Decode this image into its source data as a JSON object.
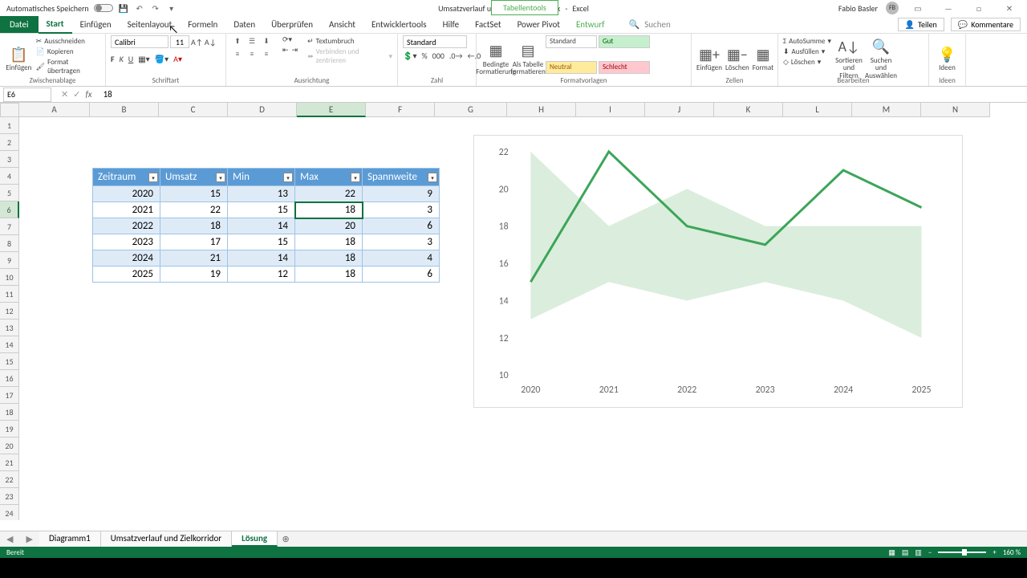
{
  "titlebar": {
    "autosave": "Automatisches Speichern",
    "doc_title": "Umsatzverlauf und Zielkorridor Grafik",
    "app_name": "Excel",
    "context_tool": "Tabellentools",
    "user": "Fabio Basler"
  },
  "tabs": {
    "file": "Datei",
    "list": [
      "Start",
      "Einfügen",
      "Seitenlayout",
      "Formeln",
      "Daten",
      "Überprüfen",
      "Ansicht",
      "Entwicklertools",
      "Hilfe",
      "FactSet",
      "Power Pivot"
    ],
    "context": "Entwurf",
    "search": "Suchen",
    "share": "Teilen",
    "comments": "Kommentare"
  },
  "ribbon": {
    "paste": "Einfügen",
    "cut": "Ausschneiden",
    "copy": "Kopieren",
    "formatpainter": "Format übertragen",
    "clipboard": "Zwischenablage",
    "font_name": "Calibri",
    "font_size": "11",
    "font_group": "Schriftart",
    "wrap": "Textumbruch",
    "merge": "Verbinden und zentrieren",
    "align_group": "Ausrichtung",
    "num_format": "Standard",
    "num_group": "Zahl",
    "cond": "Bedingte Formatierung",
    "astable": "Als Tabelle formatieren",
    "style_std": "Standard",
    "style_gut": "Gut",
    "style_neutral": "Neutral",
    "style_bad": "Schlecht",
    "styles_group": "Formatvorlagen",
    "insert": "Einfügen",
    "delete": "Löschen",
    "format": "Format",
    "cells_group": "Zellen",
    "autosum": "AutoSumme",
    "fill": "Ausfüllen",
    "clear": "Löschen",
    "sort": "Sortieren und Filtern",
    "find": "Suchen und Auswählen",
    "edit_group": "Bearbeiten",
    "ideas": "Ideen",
    "ideas_group": "Ideen"
  },
  "namebox": "E6",
  "formula": "18",
  "columns": [
    "A",
    "B",
    "C",
    "D",
    "E",
    "F",
    "G",
    "H",
    "I",
    "J",
    "K",
    "L",
    "M",
    "N"
  ],
  "rows": [
    "1",
    "2",
    "3",
    "4",
    "5",
    "6",
    "7",
    "8",
    "9",
    "10",
    "11",
    "12",
    "13",
    "14",
    "15",
    "16",
    "17",
    "18",
    "19",
    "20",
    "21",
    "22",
    "23",
    "24"
  ],
  "selected_col": "E",
  "selected_row": "6",
  "table": {
    "headers": [
      "Zeitraum",
      "Umsatz",
      "Min",
      "Max",
      "Spannweite"
    ],
    "data": [
      [
        "2020",
        "15",
        "13",
        "22",
        "9"
      ],
      [
        "2021",
        "22",
        "15",
        "18",
        "3"
      ],
      [
        "2022",
        "18",
        "14",
        "20",
        "6"
      ],
      [
        "2023",
        "17",
        "15",
        "18",
        "3"
      ],
      [
        "2024",
        "21",
        "14",
        "18",
        "4"
      ],
      [
        "2025",
        "19",
        "12",
        "18",
        "6"
      ]
    ]
  },
  "chart_data": {
    "type": "line",
    "x": [
      "2020",
      "2021",
      "2022",
      "2023",
      "2024",
      "2025"
    ],
    "series": [
      {
        "name": "Umsatz",
        "values": [
          15,
          22,
          18,
          17,
          21,
          19
        ]
      },
      {
        "name": "Min",
        "values": [
          13,
          15,
          14,
          15,
          14,
          12
        ]
      },
      {
        "name": "Max",
        "values": [
          22,
          18,
          20,
          18,
          18,
          18
        ]
      }
    ],
    "ylim": [
      10,
      22
    ],
    "yticks": [
      10,
      12,
      14,
      16,
      18,
      20,
      22
    ]
  },
  "sheets": [
    "Diagramm1",
    "Umsatzverlauf und Zielkorridor",
    "Lösung"
  ],
  "active_sheet": "Lösung",
  "status": {
    "ready": "Bereit",
    "zoom": "160 %"
  }
}
